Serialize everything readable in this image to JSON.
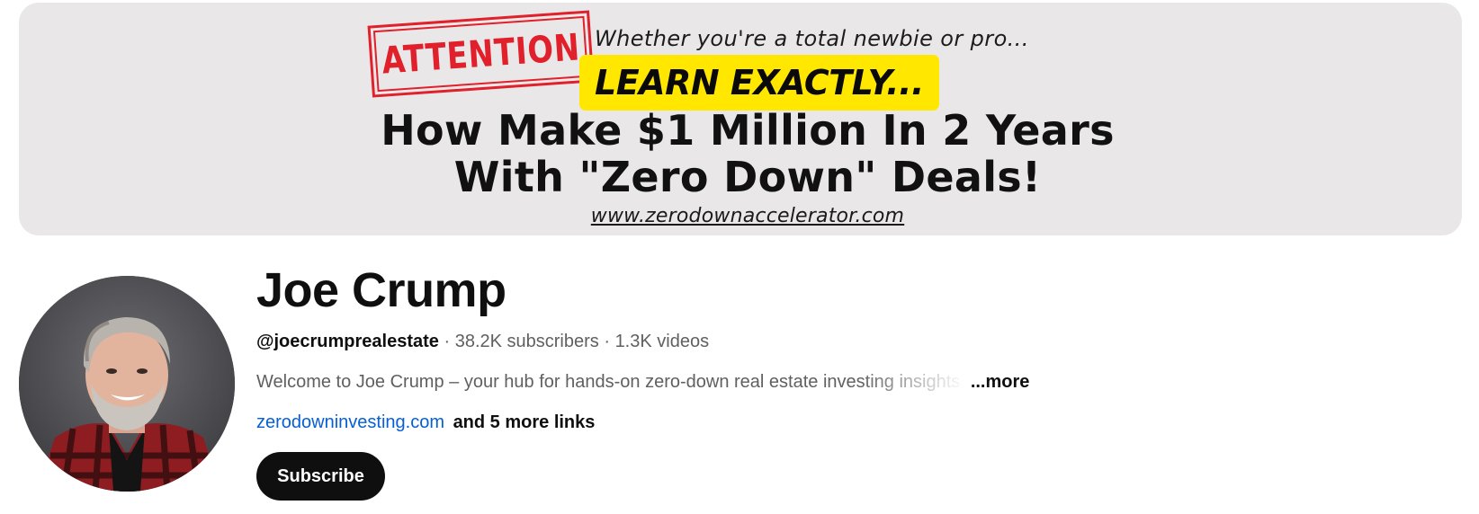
{
  "banner": {
    "stamp_text": "ATTENTION",
    "tagline": "Whether you're a total newbie or pro...",
    "highlight": "LEARN EXACTLY...",
    "headline_line1": "How Make $1 Million In 2 Years",
    "headline_line2": "With \"Zero Down\" Deals!",
    "url": "www.zerodownaccelerator.com",
    "colors": {
      "background": "#e9e7e8",
      "stamp": "#e0202a",
      "highlight": "#ffe700"
    }
  },
  "channel": {
    "name": "Joe Crump",
    "handle": "@joecrumprealestate",
    "separator": " · ",
    "subscribers": "38.2K subscribers",
    "videos": "1.3K videos",
    "description": "Welcome to Joe Crump – your hub for hands-on zero-down real estate investing insights.",
    "more_label": "...more",
    "link": "zerodowninvesting.com",
    "more_links": "and 5 more links",
    "subscribe_label": "Subscribe",
    "avatar_icon": "channel-avatar-photo"
  }
}
